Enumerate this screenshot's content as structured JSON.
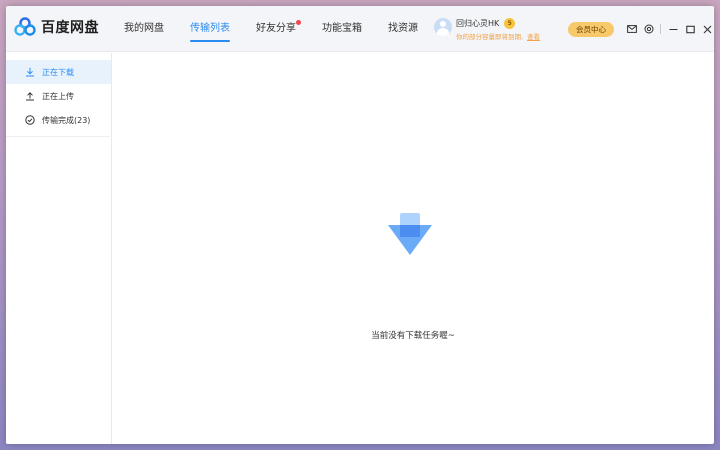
{
  "app": {
    "name": "百度网盘"
  },
  "nav": {
    "items": [
      {
        "label": "我的网盘"
      },
      {
        "label": "传输列表"
      },
      {
        "label": "好友分享"
      },
      {
        "label": "功能宝箱"
      },
      {
        "label": "找资源"
      }
    ],
    "active_index": 1
  },
  "user": {
    "name": "回归心灵HK",
    "vip_level": "5",
    "notice": "你的部分容量即将到期,",
    "notice_link": "查看"
  },
  "member_button": "会员中心",
  "sidebar": {
    "items": [
      {
        "label": "正在下载",
        "icon": "download-icon"
      },
      {
        "label": "正在上传",
        "icon": "upload-icon"
      },
      {
        "label": "传输完成(23)",
        "icon": "check-circle-icon"
      }
    ],
    "active_index": 0
  },
  "main": {
    "empty_text": "当前没有下载任务喔~",
    "empty_icon": "download-arrow-icon"
  },
  "colors": {
    "accent": "#2a8cf0",
    "badge_dot": "#f2484c",
    "member": "#f7c96b",
    "notice": "#f0a24a"
  }
}
